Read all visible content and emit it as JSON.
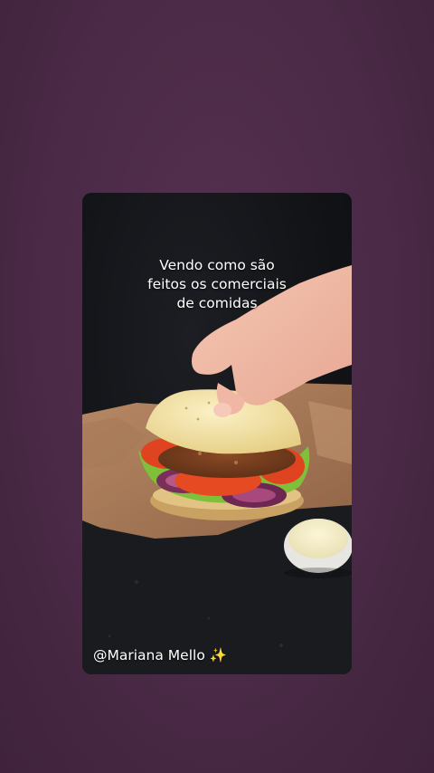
{
  "story": {
    "caption_lines": [
      "Vendo como são",
      "feitos os comerciais",
      "de comidas"
    ],
    "credit": "@Mariana Mello ✨"
  },
  "colors": {
    "background": "#4a2a46",
    "card_background": "#121317",
    "text": "#ffffff"
  }
}
